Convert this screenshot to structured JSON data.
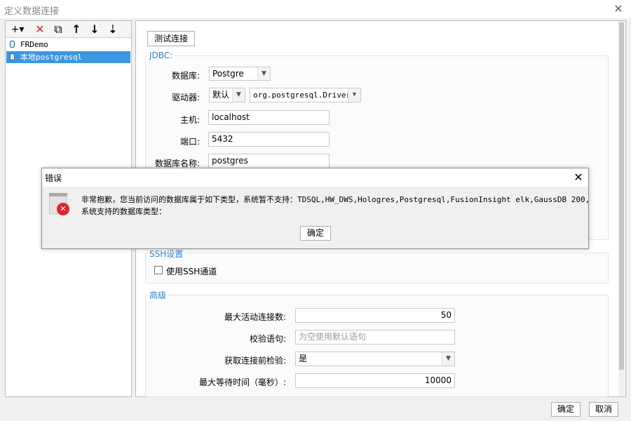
{
  "window": {
    "title": "定义数据连接",
    "close_glyph": "✕"
  },
  "toolbar": {
    "add_glyph": "+▾",
    "delete_glyph": "✕",
    "copy_glyph": "⧉",
    "up_glyph": "↑",
    "down_glyph": "↓",
    "sort_glyph": "⇣"
  },
  "connections": [
    {
      "name": "FRDemo",
      "selected": false
    },
    {
      "name": "本地postgresql",
      "selected": true
    }
  ],
  "test_button": "测试连接",
  "jdbc": {
    "section_title": "JDBC:",
    "database_label": "数据库:",
    "database_value": "Postgre",
    "driver_label": "驱动器:",
    "driver_mode": "默认",
    "driver_value": "org.postgresql.Driver",
    "host_label": "主机:",
    "host_value": "localhost",
    "port_label": "端口:",
    "port_value": "5432",
    "dbname_label": "数据库名称:",
    "dbname_value": "postgres"
  },
  "ssh": {
    "section_title": "SSH设置",
    "use_ssh_label": "使用SSH通道"
  },
  "advanced": {
    "section_title": "高级",
    "max_active_label": "最大活动连接数:",
    "max_active_value": "50",
    "validation_label": "校验语句:",
    "validation_placeholder": "为空使用默认语句",
    "test_before_label": "获取连接前检验:",
    "test_before_value": "是",
    "max_wait_label": "最大等待时间（毫秒）:",
    "max_wait_value": "10000"
  },
  "footer": {
    "ok": "确定",
    "cancel": "取消"
  },
  "error_dialog": {
    "title": "错误",
    "close_glyph": "✕",
    "line1": "非常抱歉，您当前访问的数据库属于如下类型，系统暂不支持：TDSQL,HW_DWS,Hologres,Postgresql,FusionInsight elk,GaussDB 200,",
    "line2": "系统支持的数据库类型：",
    "ok": "确定",
    "error_glyph": "✕"
  },
  "arrow_glyph": "▼",
  "colors": {
    "selection": "#3d96e0",
    "section_title": "#2f7fc9",
    "error_red": "#e0212e"
  }
}
